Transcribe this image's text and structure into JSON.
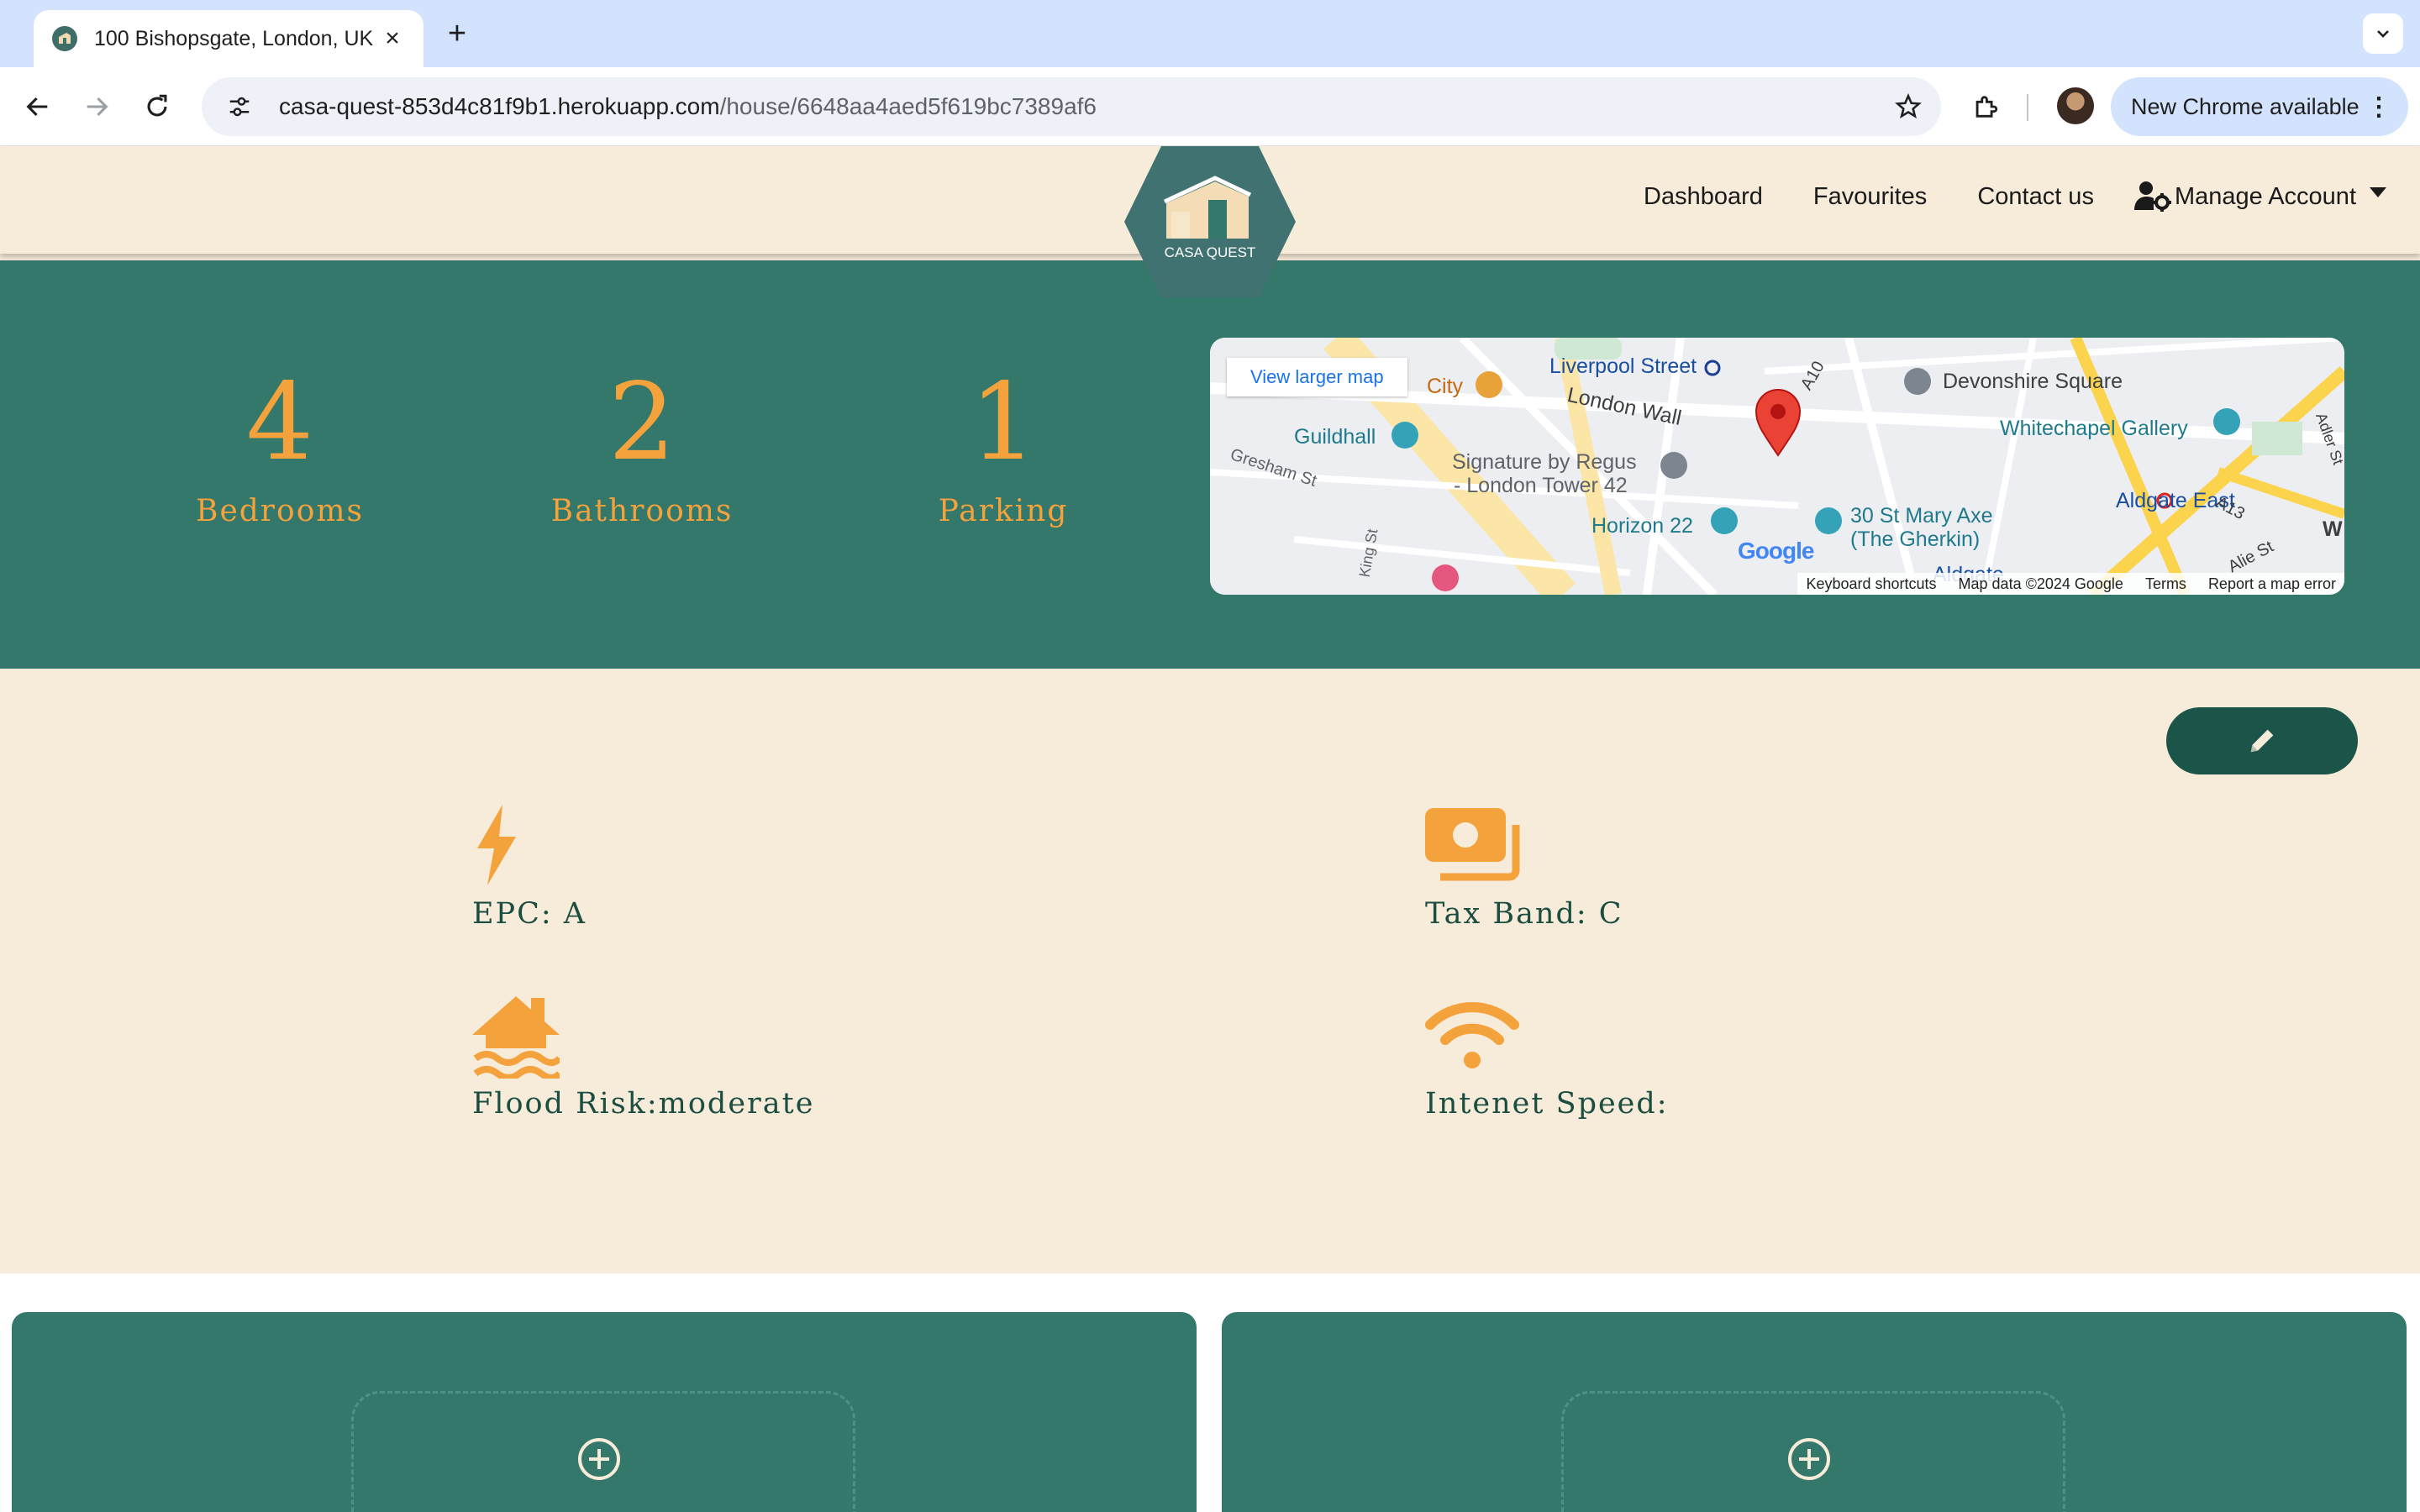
{
  "browser": {
    "tab_title": "100 Bishopsgate, London, UK",
    "url_domain": "casa-quest-853d4c81f9b1.herokuapp.com",
    "url_path": "/house/6648aa4aed5f619bc7389af6",
    "update_label": "New Chrome available"
  },
  "nav": {
    "logo_text": "CASA QUEST",
    "links": [
      "Dashboard",
      "Favourites",
      "Contact us"
    ],
    "account_label": "Manage Account"
  },
  "stats": [
    {
      "value": "4",
      "label": "Bedrooms"
    },
    {
      "value": "2",
      "label": "Bathrooms"
    },
    {
      "value": "1",
      "label": "Parking"
    }
  ],
  "map": {
    "view_larger": "View larger map",
    "places": {
      "liverpool_street": "Liverpool Street",
      "devonshire_square": "Devonshire Square",
      "city": "City",
      "london_wall": "London Wall",
      "a10": "A10",
      "guildhall": "Guildhall",
      "whitechapel_gallery": "Whitechapel Gallery",
      "gresham_st": "Gresham St",
      "signature_1": "Signature by Regus",
      "signature_2": "- London Tower 42",
      "aldgate_east": "Aldgate East",
      "a13": "A13",
      "horizon_22": "Horizon 22",
      "gherkin_1": "30 St Mary Axe",
      "gherkin_2": "(The Gherkin)",
      "king_st": "King St",
      "alie_st": "Alie St",
      "aldgate": "Aldgate",
      "adler_st": "Adler St",
      "w": "W",
      "google": "Google"
    },
    "footer": [
      "Keyboard shortcuts",
      "Map data ©2024 Google",
      "Terms",
      "Report a map error"
    ]
  },
  "features": {
    "epc": "EPC: A",
    "tax_band": "Tax Band: C",
    "flood_risk": "Flood Risk:moderate",
    "internet_speed": "Intenet Speed:"
  },
  "colors": {
    "green": "#34776b",
    "dark_green": "#1b5448",
    "orange": "#f4a23c",
    "cream": "#f7ebda"
  }
}
